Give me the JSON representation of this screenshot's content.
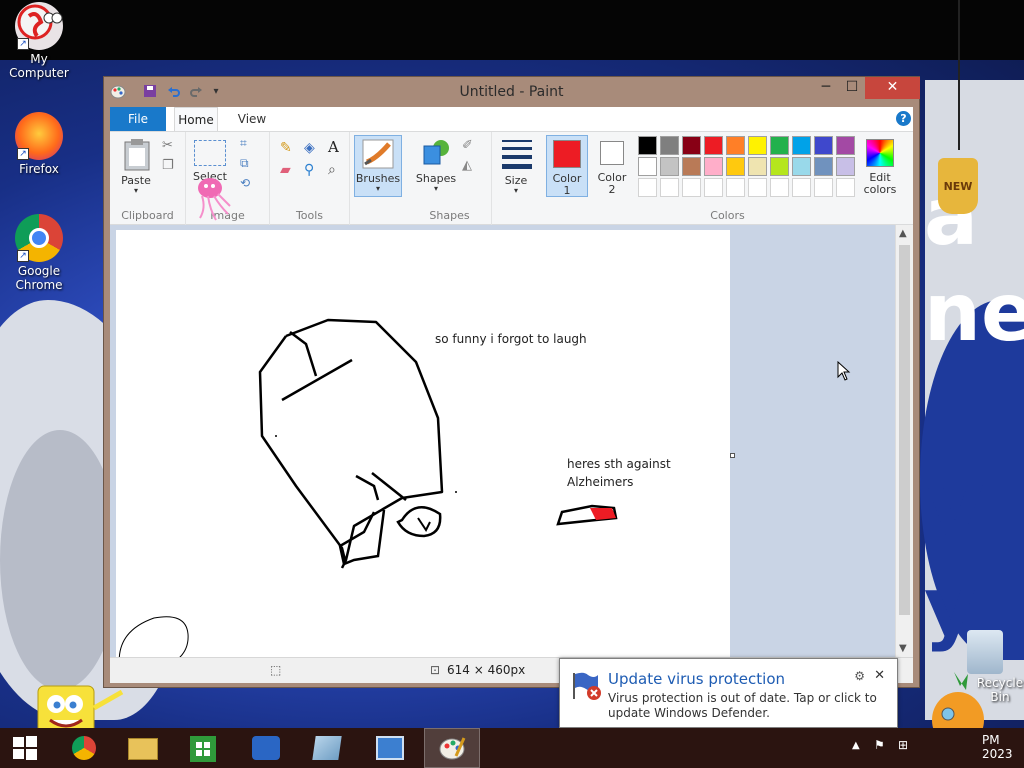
{
  "desktop": {
    "icons": [
      {
        "label": "My Computer"
      },
      {
        "label": "Firefox"
      },
      {
        "label": "Google Chrome"
      },
      {
        "label": "Recycle Bin"
      }
    ],
    "wallpaper_text": [
      "a",
      "ne",
      "V",
      "y"
    ],
    "sticker_text": "NEW"
  },
  "paint": {
    "title": "Untitled - Paint",
    "tabs": [
      "File",
      "Home",
      "View"
    ],
    "help_label": "?",
    "groups": {
      "clipboard": {
        "label": "Clipboard",
        "paste_label": "Paste"
      },
      "image": {
        "label": "Image",
        "select_label": "Select"
      },
      "tools": {
        "label": "Tools"
      },
      "brushes": {
        "label": "Brushes"
      },
      "shapes": {
        "label": "Shapes",
        "button_label": "Shapes"
      },
      "size": {
        "label": "Size"
      },
      "colors": {
        "label": "Colors",
        "color1_label": "Color",
        "color1_num": "1",
        "color2_label": "Color",
        "color2_num": "2",
        "edit_label_1": "Edit",
        "edit_label_2": "colors",
        "color1_value": "#ed1c24",
        "color2_value": "#ffffff",
        "palette_row1": [
          "#000000",
          "#7f7f7f",
          "#880015",
          "#ed1c24",
          "#ff7f27",
          "#fff200",
          "#22b14c",
          "#00a2e8",
          "#3f48cc",
          "#a349a4"
        ],
        "palette_row2": [
          "#ffffff",
          "#c3c3c3",
          "#b97a57",
          "#ffaec9",
          "#ffc90e",
          "#efe4b0",
          "#b5e61d",
          "#99d9ea",
          "#7092be",
          "#c8bfe7"
        ]
      }
    },
    "canvas_texts": {
      "line1": "so funny i forgot to laugh",
      "line2": "heres sth against",
      "line3": "Alzheimers"
    },
    "status": {
      "dimensions": "614 × 460px"
    }
  },
  "notification": {
    "title": "Update virus protection",
    "body": "Virus protection is out of date. Tap or click to update Windows Defender."
  },
  "taskbar": {
    "clock_time": "PM",
    "clock_year": "2023"
  }
}
